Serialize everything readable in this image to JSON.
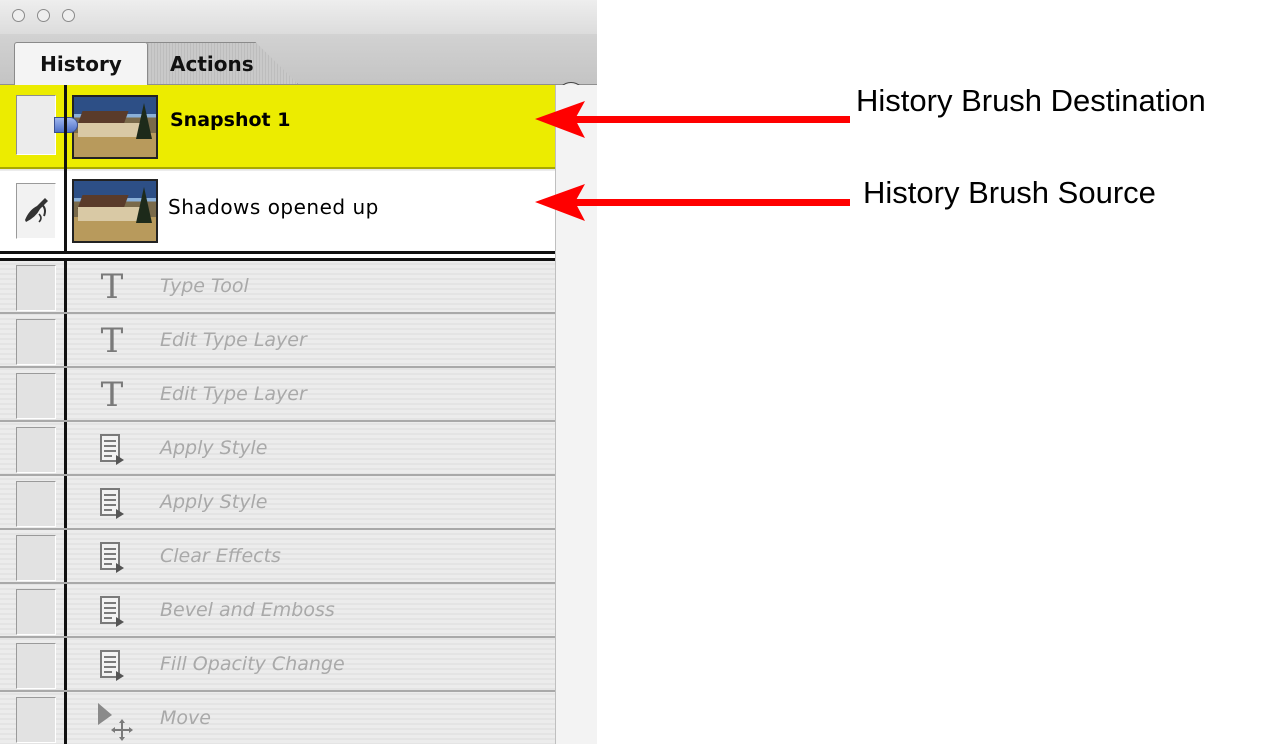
{
  "palette": {
    "tabs": [
      {
        "label": "History"
      },
      {
        "label": "Actions"
      }
    ],
    "snapshot": {
      "label": "Snapshot 1"
    },
    "source_state": {
      "label": "Shadows opened up"
    },
    "future_states": [
      {
        "label": "Type Tool",
        "icon": "type-tool-icon"
      },
      {
        "label": "Edit Type Layer",
        "icon": "type-tool-icon"
      },
      {
        "label": "Edit Type Layer",
        "icon": "type-tool-icon"
      },
      {
        "label": "Apply Style",
        "icon": "layer-style-icon"
      },
      {
        "label": "Apply Style",
        "icon": "layer-style-icon"
      },
      {
        "label": "Clear Effects",
        "icon": "layer-style-icon"
      },
      {
        "label": "Bevel and Emboss",
        "icon": "layer-style-icon"
      },
      {
        "label": "Fill Opacity Change",
        "icon": "layer-style-icon"
      },
      {
        "label": "Move",
        "icon": "move-tool-icon"
      }
    ]
  },
  "annotations": {
    "destination": "History Brush Destination",
    "source": "History Brush Source"
  },
  "colors": {
    "highlight": "#ecec00",
    "arrow": "#ff0000",
    "disabled_text": "#a9a9a9"
  }
}
